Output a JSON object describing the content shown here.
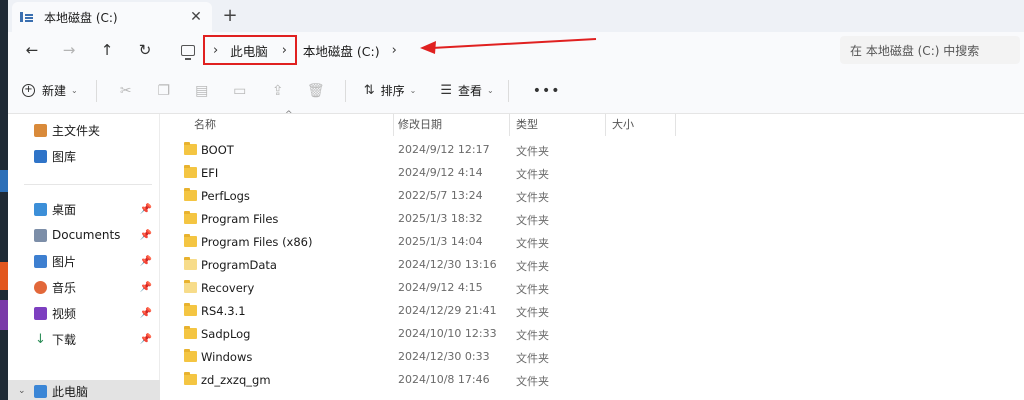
{
  "tab": {
    "title": "本地磁盘 (C:)",
    "close": "✕",
    "new_tab": "+"
  },
  "nav": {
    "back": "←",
    "forward": "→",
    "up": "↑",
    "refresh": "↻"
  },
  "address": {
    "crumbs": [
      "此电脑",
      "本地磁盘 (C:)"
    ],
    "sep": "›",
    "search_placeholder": "在 本地磁盘 (C:) 中搜索",
    "highlight_color": "#e02020"
  },
  "toolbar": {
    "new_label": "新建",
    "sort_label": "排序",
    "view_label": "查看",
    "more_label": "•••"
  },
  "sidebar": {
    "items": [
      {
        "label": "主文件夹",
        "icon": "home-icon",
        "color": "#d98a3a"
      },
      {
        "label": "图库",
        "icon": "gallery-icon",
        "color": "#2f74c8"
      },
      {
        "label": "桌面",
        "icon": "desktop-icon",
        "color": "#3c8fd8",
        "pinned": true
      },
      {
        "label": "Documents",
        "icon": "documents-icon",
        "color": "#7c8ea8",
        "pinned": true
      },
      {
        "label": "图片",
        "icon": "pictures-icon",
        "color": "#3d7fd0",
        "pinned": true
      },
      {
        "label": "音乐",
        "icon": "music-icon",
        "color": "#e2683a",
        "pinned": true
      },
      {
        "label": "视频",
        "icon": "videos-icon",
        "color": "#7d3fc0",
        "pinned": true
      },
      {
        "label": "下载",
        "icon": "downloads-icon",
        "color": "#2f8f5a",
        "pinned": true
      },
      {
        "label": "此电脑",
        "icon": "this-pc-icon",
        "color": "#3b86d6"
      }
    ]
  },
  "columns": {
    "name": "名称",
    "date": "修改日期",
    "type": "类型",
    "size": "大小"
  },
  "files": [
    {
      "name": "BOOT",
      "date": "2024/9/12 12:17",
      "type": "文件夹"
    },
    {
      "name": "EFI",
      "date": "2024/9/12 4:14",
      "type": "文件夹"
    },
    {
      "name": "PerfLogs",
      "date": "2022/5/7 13:24",
      "type": "文件夹"
    },
    {
      "name": "Program Files",
      "date": "2025/1/3 18:32",
      "type": "文件夹"
    },
    {
      "name": "Program Files (x86)",
      "date": "2025/1/3 14:04",
      "type": "文件夹"
    },
    {
      "name": "ProgramData",
      "date": "2024/12/30 13:16",
      "type": "文件夹"
    },
    {
      "name": "Recovery",
      "date": "2024/9/12 4:15",
      "type": "文件夹"
    },
    {
      "name": "RS4.3.1",
      "date": "2024/12/29 21:41",
      "type": "文件夹"
    },
    {
      "name": "SadpLog",
      "date": "2024/10/10 12:33",
      "type": "文件夹"
    },
    {
      "name": "Windows",
      "date": "2024/12/30 0:33",
      "type": "文件夹"
    },
    {
      "name": "zd_zxzq_gm",
      "date": "2024/10/8 17:46",
      "type": "文件夹"
    }
  ]
}
